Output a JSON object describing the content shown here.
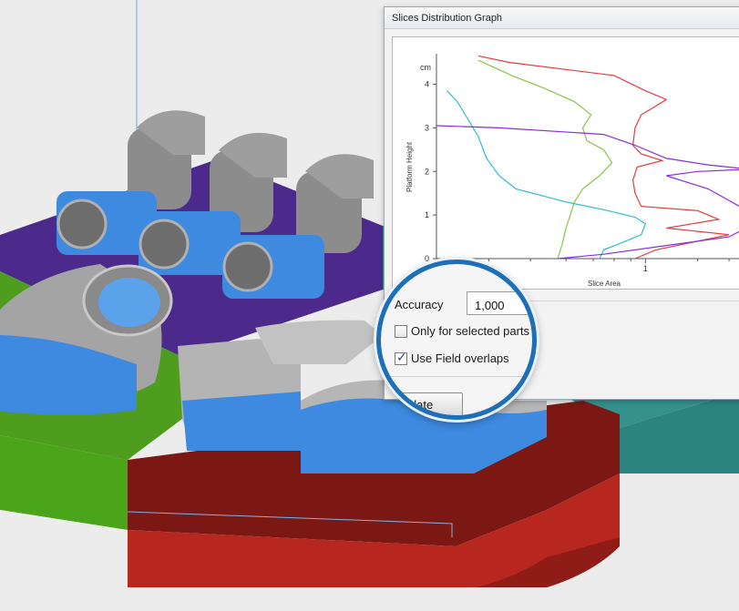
{
  "dialog": {
    "title": "Slices Distribution Graph",
    "accuracy_label": "Accuracy",
    "accuracy_value": "1,000",
    "only_selected_label": "Only for selected parts",
    "only_selected_checked": false,
    "use_field_overlaps_label": "Use Field overlaps",
    "use_field_overlaps_checked": true,
    "calculate_label": "Calculate"
  },
  "colors": {
    "build_zone_purple": "#4b2a8c",
    "build_zone_green": "#4a9a1a",
    "build_zone_red": "#9c1c18",
    "build_zone_teal": "#2f8a86",
    "support_blue": "#3b8fe0",
    "part_gray": "#9a9a9a",
    "lens_border": "#1f6fb8"
  },
  "chart_data": {
    "type": "line",
    "ylabel": "Platform Height",
    "yunit": "cm",
    "xlabel": "Slice Area",
    "ylim": [
      0,
      4.7
    ],
    "xlim": [
      0,
      1.5
    ],
    "yticks": [
      "0",
      "1",
      "2",
      "3",
      "4"
    ],
    "xticks": [
      "1"
    ],
    "series": [
      {
        "color": "#e83a3a",
        "points": [
          [
            0.95,
            0.0
          ],
          [
            1.05,
            0.2
          ],
          [
            1.4,
            0.55
          ],
          [
            1.1,
            0.7
          ],
          [
            1.35,
            0.9
          ],
          [
            1.25,
            1.1
          ],
          [
            0.98,
            1.2
          ],
          [
            0.95,
            1.5
          ],
          [
            0.94,
            1.8
          ],
          [
            0.96,
            2.1
          ],
          [
            1.08,
            2.25
          ],
          [
            0.98,
            2.4
          ],
          [
            0.94,
            2.6
          ],
          [
            0.95,
            3.0
          ],
          [
            0.98,
            3.3
          ],
          [
            1.05,
            3.5
          ],
          [
            1.1,
            3.65
          ],
          [
            1.0,
            3.85
          ],
          [
            0.85,
            4.2
          ],
          [
            0.35,
            4.5
          ],
          [
            0.2,
            4.65
          ]
        ]
      },
      {
        "color": "#8bc34a",
        "points": [
          [
            0.58,
            0.0
          ],
          [
            0.6,
            0.3
          ],
          [
            0.62,
            0.7
          ],
          [
            0.64,
            1.0
          ],
          [
            0.66,
            1.3
          ],
          [
            0.7,
            1.6
          ],
          [
            0.78,
            1.9
          ],
          [
            0.84,
            2.2
          ],
          [
            0.8,
            2.5
          ],
          [
            0.72,
            2.7
          ],
          [
            0.7,
            3.0
          ],
          [
            0.74,
            3.3
          ],
          [
            0.66,
            3.6
          ],
          [
            0.52,
            3.9
          ],
          [
            0.36,
            4.2
          ],
          [
            0.2,
            4.55
          ]
        ]
      },
      {
        "color": "#2bbcd0",
        "points": [
          [
            0.78,
            0.0
          ],
          [
            0.8,
            0.2
          ],
          [
            0.88,
            0.35
          ],
          [
            0.98,
            0.55
          ],
          [
            1.0,
            0.8
          ],
          [
            0.95,
            0.95
          ],
          [
            0.82,
            1.1
          ],
          [
            0.62,
            1.3
          ],
          [
            0.5,
            1.45
          ],
          [
            0.38,
            1.6
          ],
          [
            0.3,
            1.9
          ],
          [
            0.24,
            2.3
          ],
          [
            0.2,
            2.8
          ],
          [
            0.15,
            3.2
          ],
          [
            0.1,
            3.6
          ],
          [
            0.05,
            3.85
          ]
        ]
      },
      {
        "color": "#8a2be2",
        "points": [
          [
            0.58,
            0.0
          ],
          [
            0.8,
            0.1
          ],
          [
            1.1,
            0.3
          ],
          [
            1.4,
            0.5
          ],
          [
            1.5,
            0.75
          ],
          [
            1.45,
            1.2
          ],
          [
            1.3,
            1.6
          ],
          [
            1.1,
            1.9
          ],
          [
            1.25,
            2.0
          ],
          [
            1.5,
            2.05
          ],
          [
            1.3,
            2.15
          ],
          [
            1.1,
            2.3
          ],
          [
            0.95,
            2.6
          ],
          [
            0.8,
            2.85
          ],
          [
            0.3,
            3.0
          ],
          [
            0.0,
            3.05
          ]
        ]
      }
    ]
  }
}
